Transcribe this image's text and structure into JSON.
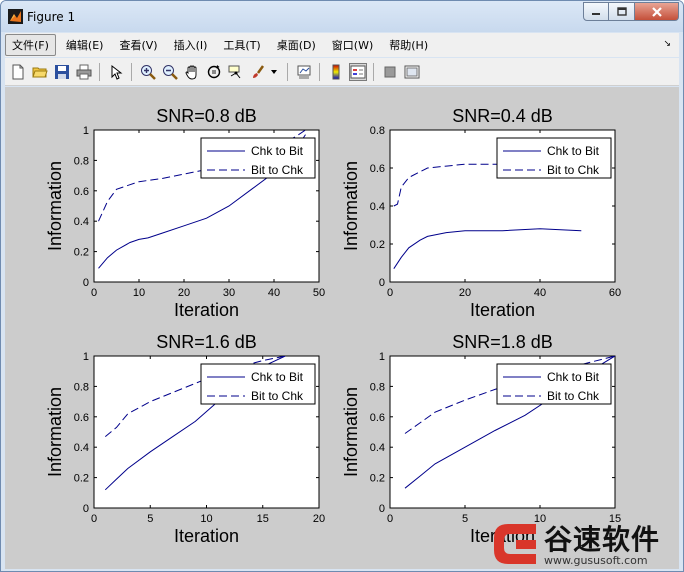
{
  "window": {
    "title": "Figure 1"
  },
  "menu": {
    "items": [
      "文件(F)",
      "编辑(E)",
      "查看(V)",
      "插入(I)",
      "工具(T)",
      "桌面(D)",
      "窗口(W)",
      "帮助(H)"
    ]
  },
  "toolbar": {
    "icons": [
      "new-figure-icon",
      "open-file-icon",
      "save-icon",
      "print-icon",
      "edit-plot-arrow-icon",
      "zoom-in-icon",
      "zoom-out-icon",
      "pan-hand-icon",
      "rotate-3d-icon",
      "data-cursor-icon",
      "brush-icon",
      "brush-dropdown-icon",
      "link-plot-icon",
      "insert-colorbar-icon",
      "insert-legend-icon",
      "hide-plot-tools-icon",
      "show-plot-tools-icon"
    ]
  },
  "colors": {
    "plot_line": "#00008b",
    "figure_bg": "#cccccc",
    "axes_bg": "#ffffff"
  },
  "chart_data": [
    {
      "type": "line",
      "title": "SNR=0.8 dB",
      "xlabel": "Iteration",
      "ylabel": "Information",
      "xlim": [
        0,
        50
      ],
      "ylim": [
        0,
        1
      ],
      "xticks": [
        "0",
        "10",
        "20",
        "30",
        "40",
        "50"
      ],
      "yticks": [
        "0",
        "0.2",
        "0.4",
        "0.6",
        "0.8",
        "1"
      ],
      "legend": {
        "position": "top-right",
        "entries": [
          "Chk to Bit",
          "Bit to Chk"
        ]
      },
      "series": [
        {
          "name": "Chk to Bit",
          "style": "solid",
          "x": [
            1,
            3,
            5,
            8,
            10,
            12,
            15,
            20,
            25,
            30,
            35,
            40,
            45,
            47
          ],
          "y": [
            0.09,
            0.16,
            0.21,
            0.26,
            0.28,
            0.29,
            0.32,
            0.37,
            0.42,
            0.5,
            0.61,
            0.72,
            0.88,
            0.97
          ]
        },
        {
          "name": "Bit to Chk",
          "style": "dashed",
          "x": [
            1,
            3,
            5,
            8,
            10,
            15,
            20,
            25,
            30,
            35,
            40,
            45,
            47
          ],
          "y": [
            0.4,
            0.53,
            0.61,
            0.64,
            0.66,
            0.68,
            0.71,
            0.74,
            0.77,
            0.82,
            0.88,
            0.96,
            1.0
          ]
        }
      ]
    },
    {
      "type": "line",
      "title": "SNR=0.4 dB",
      "xlabel": "Iteration",
      "ylabel": "Information",
      "xlim": [
        0,
        60
      ],
      "ylim": [
        0,
        0.8
      ],
      "xticks": [
        "0",
        "20",
        "40",
        "60"
      ],
      "yticks": [
        "0",
        "0.2",
        "0.4",
        "0.6",
        "0.8"
      ],
      "legend": {
        "position": "top-right",
        "entries": [
          "Chk to Bit",
          "Bit to Chk"
        ]
      },
      "series": [
        {
          "name": "Chk to Bit",
          "style": "solid",
          "x": [
            1,
            3,
            5,
            8,
            10,
            15,
            20,
            30,
            40,
            51
          ],
          "y": [
            0.07,
            0.13,
            0.18,
            0.22,
            0.24,
            0.26,
            0.27,
            0.27,
            0.28,
            0.27
          ]
        },
        {
          "name": "Bit to Chk",
          "style": "dashed",
          "x": [
            1,
            2,
            3,
            5,
            8,
            10,
            15,
            20,
            30,
            40,
            51
          ],
          "y": [
            0.4,
            0.41,
            0.5,
            0.55,
            0.58,
            0.6,
            0.61,
            0.62,
            0.62,
            0.63,
            0.63
          ]
        }
      ]
    },
    {
      "type": "line",
      "title": "SNR=1.6 dB",
      "xlabel": "Iteration",
      "ylabel": "Information",
      "xlim": [
        0,
        20
      ],
      "ylim": [
        0,
        1
      ],
      "xticks": [
        "0",
        "5",
        "10",
        "15",
        "20"
      ],
      "yticks": [
        "0",
        "0.2",
        "0.4",
        "0.6",
        "0.8",
        "1"
      ],
      "legend": {
        "position": "top-right",
        "entries": [
          "Chk to Bit",
          "Bit to Chk"
        ]
      },
      "series": [
        {
          "name": "Chk to Bit",
          "style": "solid",
          "x": [
            1,
            2,
            3,
            5,
            7,
            9,
            11,
            13,
            15,
            17
          ],
          "y": [
            0.12,
            0.19,
            0.26,
            0.37,
            0.47,
            0.57,
            0.7,
            0.82,
            0.93,
            1.0
          ]
        },
        {
          "name": "Bit to Chk",
          "style": "dashed",
          "x": [
            1,
            2,
            3,
            5,
            7,
            9,
            11,
            13,
            15,
            17
          ],
          "y": [
            0.47,
            0.53,
            0.62,
            0.7,
            0.76,
            0.82,
            0.88,
            0.93,
            0.97,
            1.0
          ]
        }
      ]
    },
    {
      "type": "line",
      "title": "SNR=1.8 dB",
      "xlabel": "Iteration",
      "ylabel": "Information",
      "xlim": [
        0,
        15
      ],
      "ylim": [
        0,
        1
      ],
      "xticks": [
        "0",
        "5",
        "10",
        "15"
      ],
      "yticks": [
        "0",
        "0.2",
        "0.4",
        "0.6",
        "0.8",
        "1"
      ],
      "legend": {
        "position": "top-right",
        "entries": [
          "Chk to Bit",
          "Bit to Chk"
        ]
      },
      "series": [
        {
          "name": "Chk to Bit",
          "style": "solid",
          "x": [
            1,
            2,
            3,
            5,
            7,
            9,
            11,
            13,
            15
          ],
          "y": [
            0.13,
            0.21,
            0.29,
            0.4,
            0.51,
            0.61,
            0.74,
            0.88,
            1.0
          ]
        },
        {
          "name": "Bit to Chk",
          "style": "dashed",
          "x": [
            1,
            2,
            3,
            5,
            7,
            9,
            11,
            13,
            15
          ],
          "y": [
            0.49,
            0.56,
            0.63,
            0.71,
            0.78,
            0.84,
            0.9,
            0.95,
            1.0
          ]
        }
      ]
    }
  ],
  "watermark": {
    "brand": "谷速软件",
    "url": "www.gususoft.com"
  }
}
